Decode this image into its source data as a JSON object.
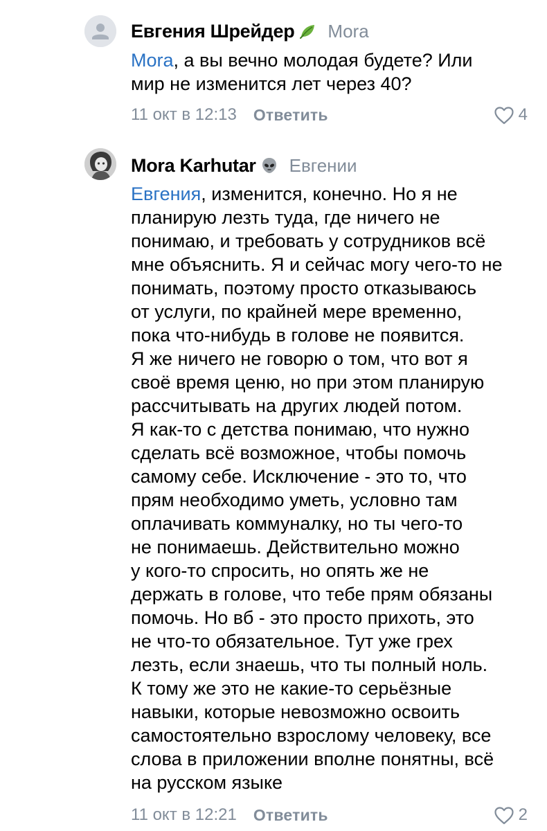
{
  "comments": [
    {
      "author": "Евгения Шрейдер",
      "author_badge_icon": "leaf-icon",
      "reply_to": "Mora",
      "mention": "Mora",
      "text": ", а вы вечно молодая будете? Или\nмир не изменится лет через 40?",
      "date": "11 окт в 12:13",
      "reply_label": "Ответить",
      "likes": "4"
    },
    {
      "author": "Mora Karhutar",
      "author_badge_icon": "alien-icon",
      "reply_to": "Евгении",
      "mention": "Евгения",
      "text": ", изменится, конечно. Но я не\nпланирую лезть туда, где ничего не\nпонимаю, и требовать у сотрудников всё\nмне объяснить. Я и сейчас могу чего-то не\nпонимать, поэтому просто отказываюсь\nот услуги, по крайней мере временно,\nпока что-нибудь в голове не появится.\nЯ же ничего не говорю о том, что вот я\nсвоё время ценю, но при этом планирую\nрассчитывать на других людей потом.\nЯ как-то с детства понимаю, что нужно\nсделать всё возможное, чтобы помочь\nсамому себе. Исключение - это то, что\nпрям необходимо уметь, условно там\nоплачивать коммуналку, но ты чего-то\nне понимаешь. Действительно можно\nу кого-то спросить, но опять же не\nдержать в голове, что тебе прям обязаны\nпомочь. Но вб - это просто прихоть, это\nне что-то обязательное. Тут уже грех\nлезть, если знаешь, что ты полный ноль.\nК тому же это не какие-то серьёзные\nнавыки, которые невозможно освоить\nсамостоятельно взрослому человеку, все\nслова в приложении вполне понятны, всё\nна русском языке",
      "date": "11 окт в 12:21",
      "reply_label": "Ответить",
      "likes": "2"
    }
  ],
  "colors": {
    "text": "#000000",
    "secondary": "#818c99",
    "mention": "#2a72c4",
    "background": "#ffffff"
  }
}
